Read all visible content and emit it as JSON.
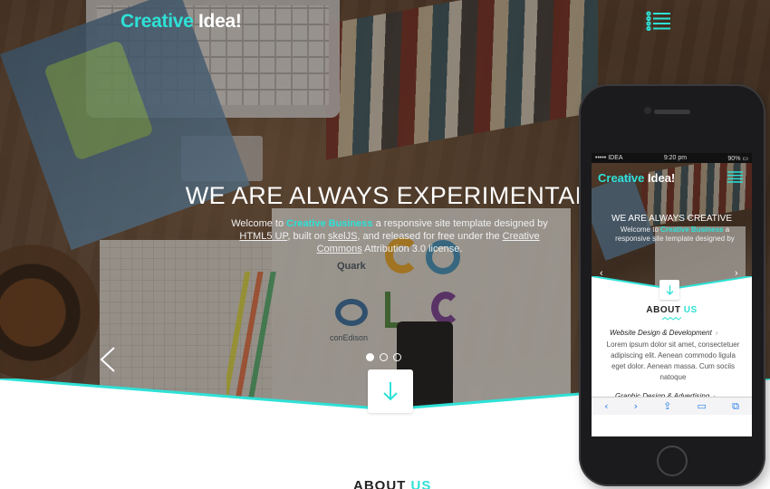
{
  "brand": {
    "part1": "Creative",
    "part2": " Idea!"
  },
  "hero": {
    "title": "WE ARE ALWAYS EXPERIMENTAL",
    "text_1": "Welcome to ",
    "text_link": "Creative Business",
    "text_2": " a responsive site template designed by ",
    "text_html5": "HTML5 UP",
    "text_3": ", built on ",
    "text_skel": "skelJS",
    "text_4": ", and released for free under the ",
    "text_cc": "Creative Commons",
    "text_5": " Attribution 3.0 license.",
    "logo_quark": "Quark",
    "logo_conedison": "conEdison"
  },
  "slider": {
    "prev_icon": "chevron-left-icon",
    "dots": 3,
    "active_dot": 0
  },
  "about": {
    "part1": "ABOUT",
    "part2": " US"
  },
  "colors": {
    "accent": "#2ee1d6"
  },
  "phone": {
    "status_carrier": "••••• IDEA",
    "status_time": "9:20 pm",
    "status_battery": "90% ▭",
    "brand_part1": "Creative",
    "brand_part2": " Idea!",
    "title": "WE ARE ALWAYS CREATIVE",
    "text_1": "Welcome to ",
    "text_link": "Creative Business",
    "text_2": " a responsive site template designed by",
    "prev": "‹",
    "next": "›",
    "about_part1": "ABOUT",
    "about_part2": " US",
    "item1": "Website Design & Development",
    "item1_chev": "›",
    "paragraph": "Lorem ipsum dolor sit amet, consectetuer adipiscing elit. Aenean commodo ligula eget dolor. Aenean massa. Cum sociis natoque",
    "item2": "Graphic Design & Advertising",
    "item2_chev": "›",
    "toolbar": {
      "back": "‹",
      "forward": "›",
      "share": "⇪",
      "bookmarks": "▭",
      "tabs": "⧉"
    }
  }
}
